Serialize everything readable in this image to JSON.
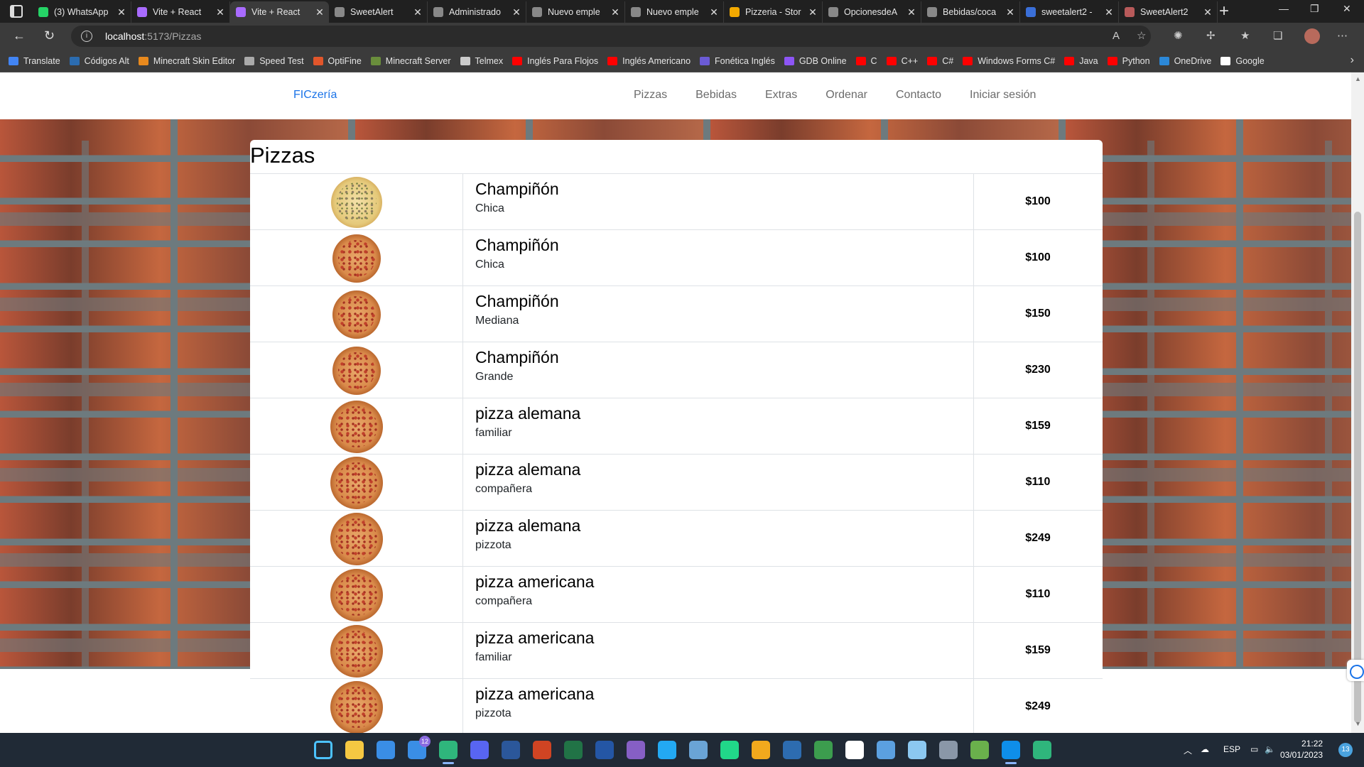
{
  "browser": {
    "tabs": [
      {
        "title": "(3) WhatsApp",
        "color": "#25d366"
      },
      {
        "title": "Vite + React",
        "color": "#a96bff"
      },
      {
        "title": "Vite + React",
        "color": "#a96bff"
      },
      {
        "title": "SweetAlert",
        "color": "#888888"
      },
      {
        "title": "Administrado",
        "color": "#888888"
      },
      {
        "title": "Nuevo emple",
        "color": "#888888"
      },
      {
        "title": "Nuevo emple",
        "color": "#888888"
      },
      {
        "title": "Pizzeria - Stor",
        "color": "#f2a900"
      },
      {
        "title": "OpcionesdeA",
        "color": "#888888"
      },
      {
        "title": "Bebidas/coca",
        "color": "#888888"
      },
      {
        "title": "sweetalert2 -",
        "color": "#3a6fd8"
      },
      {
        "title": "SweetAlert2",
        "color": "#b85a5a"
      }
    ],
    "active_tab_index": 2,
    "url_host": "localhost",
    "url_path": ":5173/Pizzas",
    "bookmarks": [
      {
        "label": "Translate",
        "color": "#4285f4"
      },
      {
        "label": "Códigos Alt",
        "color": "#2b6cb0"
      },
      {
        "label": "Minecraft Skin Editor",
        "color": "#e8891d"
      },
      {
        "label": "Speed Test",
        "color": "#aaaaaa"
      },
      {
        "label": "OptiFine",
        "color": "#e2562b"
      },
      {
        "label": "Minecraft Server",
        "color": "#6a8e3c"
      },
      {
        "label": "Telmex",
        "color": "#cccccc"
      },
      {
        "label": "Inglés Para Flojos",
        "color": "#ff0000"
      },
      {
        "label": "Inglés Americano",
        "color": "#ff0000"
      },
      {
        "label": "Fonética Inglés",
        "color": "#6b5bd6"
      },
      {
        "label": "GDB Online",
        "color": "#8d55f5"
      },
      {
        "label": "C",
        "color": "#ff0000"
      },
      {
        "label": "C++",
        "color": "#ff0000"
      },
      {
        "label": "C#",
        "color": "#ff0000"
      },
      {
        "label": "Windows Forms C#",
        "color": "#ff0000"
      },
      {
        "label": "Java",
        "color": "#ff0000"
      },
      {
        "label": "Python",
        "color": "#ff0000"
      },
      {
        "label": "OneDrive",
        "color": "#2b88d8"
      },
      {
        "label": "Google",
        "color": "#ffffff"
      }
    ]
  },
  "site": {
    "brand": "FICzería",
    "nav": [
      "Pizzas",
      "Bebidas",
      "Extras",
      "Ordenar",
      "Contacto",
      "Iniciar sesión"
    ],
    "section_title": "Pizzas",
    "products": [
      {
        "name": "Champiñón",
        "size": "Chica",
        "price": "$100",
        "style": "cheese",
        "image_size": 72
      },
      {
        "name": "Champiñón",
        "size": "Chica",
        "price": "$100",
        "style": "pep",
        "image_size": 68
      },
      {
        "name": "Champiñón",
        "size": "Mediana",
        "price": "$150",
        "style": "pep",
        "image_size": 68
      },
      {
        "name": "Champiñón",
        "size": "Grande",
        "price": "$230",
        "style": "pep",
        "image_size": 68
      },
      {
        "name": "pizza alemana",
        "size": "familiar",
        "price": "$159",
        "style": "pep",
        "image_size": 74
      },
      {
        "name": "pizza alemana",
        "size": "compañera",
        "price": "$110",
        "style": "pep",
        "image_size": 74
      },
      {
        "name": "pizza alemana",
        "size": "pizzota",
        "price": "$249",
        "style": "pep",
        "image_size": 74
      },
      {
        "name": "pizza americana",
        "size": "compañera",
        "price": "$110",
        "style": "pep",
        "image_size": 74
      },
      {
        "name": "pizza americana",
        "size": "familiar",
        "price": "$159",
        "style": "pep",
        "image_size": 74
      },
      {
        "name": "pizza americana",
        "size": "pizzota",
        "price": "$249",
        "style": "pep",
        "image_size": 74
      }
    ]
  },
  "taskbar": {
    "icons": [
      {
        "name": "windows-start-icon",
        "color": "#4cc2ff"
      },
      {
        "name": "file-explorer-icon",
        "color": "#f5c842"
      },
      {
        "name": "microsoft-store-icon",
        "color": "#3a8ee6"
      },
      {
        "name": "mail-icon",
        "color": "#3a8ee6"
      },
      {
        "name": "edge-icon",
        "color": "#2fb67c"
      },
      {
        "name": "discord-icon",
        "color": "#5865f2"
      },
      {
        "name": "word-icon",
        "color": "#2b579a"
      },
      {
        "name": "powerpoint-icon",
        "color": "#d04423"
      },
      {
        "name": "excel-icon",
        "color": "#217346"
      },
      {
        "name": "devc-icon",
        "color": "#2456a5"
      },
      {
        "name": "visual-studio-icon",
        "color": "#865fc5"
      },
      {
        "name": "vscode-icon",
        "color": "#23a9f2"
      },
      {
        "name": "virtualbox-icon",
        "color": "#6aa4d6"
      },
      {
        "name": "pycharm-icon",
        "color": "#21d789"
      },
      {
        "name": "sublime-icon",
        "color": "#f2a91d"
      },
      {
        "name": "mysql-icon",
        "color": "#2d6cb0"
      },
      {
        "name": "chrome-icon",
        "color": "#3c9d4e"
      },
      {
        "name": "zoom-icon",
        "color": "#ffffff"
      },
      {
        "name": "maps-icon",
        "color": "#5ba0e0"
      },
      {
        "name": "notepad-icon",
        "color": "#8cc8f0"
      },
      {
        "name": "calculator-icon",
        "color": "#8a97a8"
      },
      {
        "name": "minecraft-icon",
        "color": "#6ab04c"
      },
      {
        "name": "teamviewer-icon",
        "color": "#0e8ee9"
      },
      {
        "name": "edge-dev-icon",
        "color": "#2fb67c"
      }
    ],
    "mail_badge": "12",
    "language": "ESP",
    "time": "21:22",
    "date": "03/01/2023",
    "notifications": "13"
  }
}
